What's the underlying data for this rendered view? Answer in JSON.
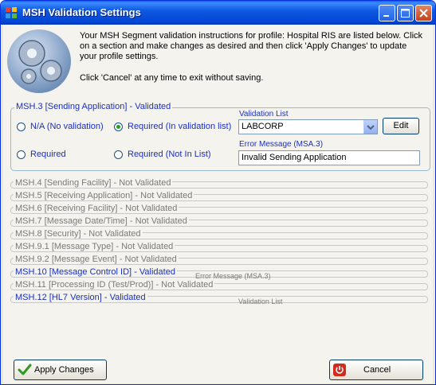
{
  "window": {
    "title": "MSH Validation Settings"
  },
  "instructions": {
    "line1": "Your MSH Segment validation instructions for profile: Hospital RIS are listed below. Click on a section and make changes as desired and then click 'Apply Changes' to update your profile settings.",
    "line2": "Click 'Cancel' at any time to exit without saving."
  },
  "active_section": {
    "label": "MSH.3 [Sending Application] - Validated",
    "options": {
      "na": "N/A (No validation)",
      "required_in_list": "Required (In validation list)",
      "required": "Required",
      "required_not_in_list": "Required (Not In List)"
    },
    "selected_option": "required_in_list",
    "validation_list_label": "Validation List",
    "validation_list_value": "LABCORP",
    "edit_label": "Edit",
    "error_message_label": "Error Message (MSA.3)",
    "error_message_value": "Invalid Sending Application"
  },
  "sections": [
    {
      "label": "MSH.4 [Sending Facility] - Not Validated",
      "validated": false
    },
    {
      "label": "MSH.5 [Receiving Application] - Not Validated",
      "validated": false
    },
    {
      "label": "MSH.6 [Receiving Facility] - Not Validated",
      "validated": false
    },
    {
      "label": "MSH.7 [Message Date/Time] - Not Validated",
      "validated": false
    },
    {
      "label": "MSH.8 [Security] - Not Validated",
      "validated": false
    },
    {
      "label": "MSH.9.1 [Message Type] - Not Validated",
      "validated": false
    },
    {
      "label": "MSH.9.2 [Message Event] - Not Validated",
      "validated": false
    },
    {
      "label": "MSH.10 [Message Control ID] - Validated",
      "validated": true
    },
    {
      "label": "MSH.11 [Processing ID (Test/Prod)] - Not Validated",
      "validated": false
    },
    {
      "label": "MSH.12 [HL7 Version] - Validated",
      "validated": true
    }
  ],
  "ghost_labels": {
    "error_message": "Error Message (MSA.3)",
    "validation_list": "Validation List"
  },
  "buttons": {
    "apply": "Apply Changes",
    "cancel": "Cancel"
  },
  "colors": {
    "validated": "#1a2fc0",
    "not_validated": "#7a7a7a",
    "titlebar": "#0346d6"
  }
}
